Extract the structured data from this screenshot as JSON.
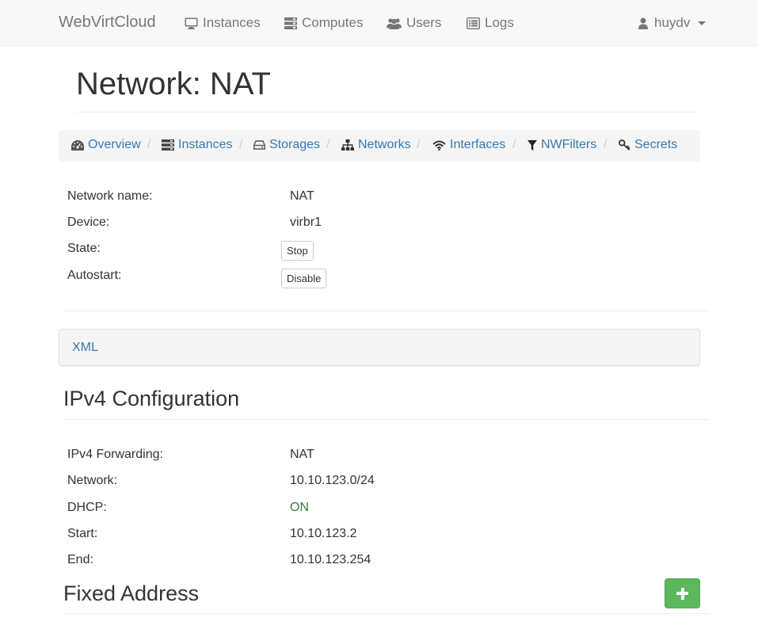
{
  "navbar": {
    "brand": "WebVirtCloud",
    "links": [
      {
        "label": "Instances",
        "icon": "monitor-icon"
      },
      {
        "label": "Computes",
        "icon": "server-icon"
      },
      {
        "label": "Users",
        "icon": "users-icon"
      },
      {
        "label": "Logs",
        "icon": "list-icon"
      }
    ],
    "user": {
      "name": "huydv",
      "icon": "user-icon"
    }
  },
  "page_title": "Network: NAT",
  "breadcrumb": [
    {
      "label": "Overview",
      "icon": "dashboard-icon"
    },
    {
      "label": "Instances",
      "icon": "server-icon"
    },
    {
      "label": "Storages",
      "icon": "hdd-icon"
    },
    {
      "label": "Networks",
      "icon": "sitemap-icon"
    },
    {
      "label": "Interfaces",
      "icon": "wifi-icon"
    },
    {
      "label": "NWFilters",
      "icon": "filter-icon"
    },
    {
      "label": "Secrets",
      "icon": "key-icon"
    }
  ],
  "breadcrumb_separator": "/",
  "network_info": {
    "name_label": "Network name:",
    "name_value": "NAT",
    "device_label": "Device:",
    "device_value": "virbr1",
    "state_label": "State:",
    "state_button": "Stop",
    "autostart_label": "Autostart:",
    "autostart_button": "Disable"
  },
  "xml_panel": {
    "label": "XML"
  },
  "ipv4": {
    "title": "IPv4 Configuration",
    "forwarding_label": "IPv4 Forwarding:",
    "forwarding_value": "NAT",
    "network_label": "Network:",
    "network_value": "10.10.123.0/24",
    "dhcp_label": "DHCP:",
    "dhcp_value": "ON",
    "start_label": "Start:",
    "start_value": "10.10.123.2",
    "end_label": "End:",
    "end_value": "10.10.123.254"
  },
  "fixed_address": {
    "title": "Fixed Address",
    "add_button_icon": "plus-icon"
  },
  "colors": {
    "link": "#337ab7",
    "success": "#5cb85c",
    "on_text": "#3c763d",
    "navbar_bg": "#f8f8f8"
  }
}
